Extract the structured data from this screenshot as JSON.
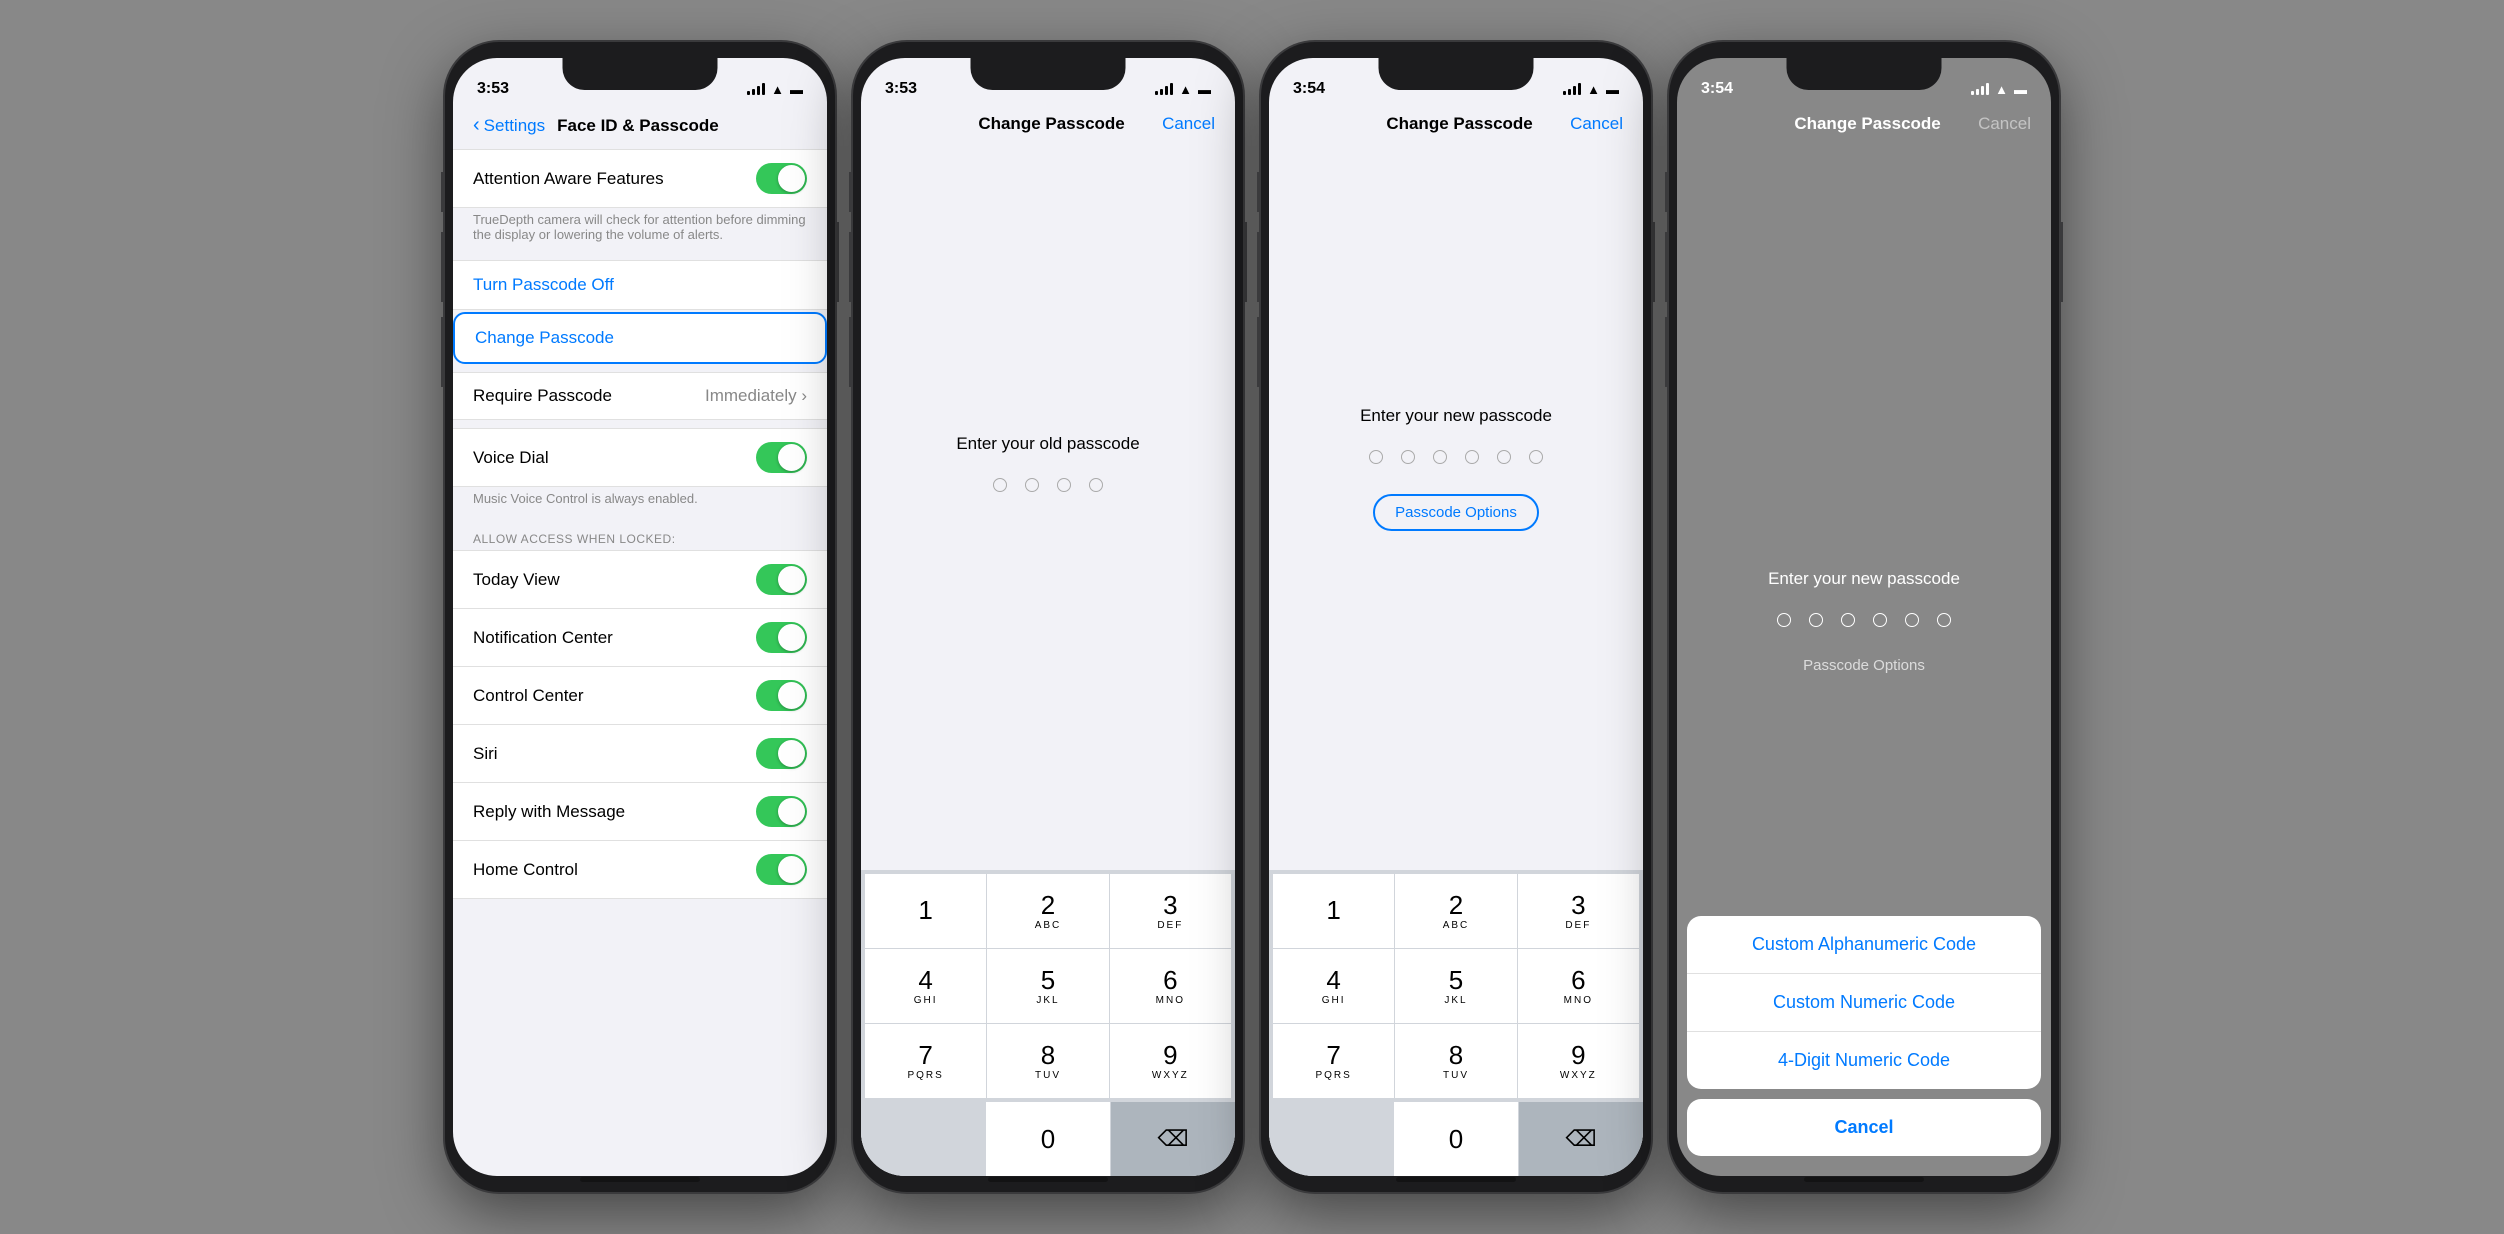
{
  "phones": [
    {
      "id": "phone1",
      "time": "3:53",
      "screen": "settings",
      "title": "Face ID & Passcode",
      "back_label": "Settings",
      "sections": [
        {
          "rows": [
            {
              "label": "Attention Aware Features",
              "type": "toggle",
              "value": true
            }
          ],
          "sublabel": "TrueDepth camera will check for attention before dimming the display or lowering the volume of alerts."
        },
        {
          "rows": [
            {
              "label": "Turn Passcode Off",
              "type": "link"
            },
            {
              "label": "Change Passcode",
              "type": "highlighted-link"
            }
          ]
        },
        {
          "rows": [
            {
              "label": "Require Passcode",
              "value": "Immediately",
              "type": "navigate"
            }
          ]
        },
        {
          "rows": [
            {
              "label": "Voice Dial",
              "type": "toggle",
              "value": true
            }
          ],
          "sublabel": "Music Voice Control is always enabled."
        },
        {
          "header": "ALLOW ACCESS WHEN LOCKED:",
          "rows": [
            {
              "label": "Today View",
              "type": "toggle",
              "value": true
            },
            {
              "label": "Notification Center",
              "type": "toggle",
              "value": true
            },
            {
              "label": "Control Center",
              "type": "toggle",
              "value": true
            },
            {
              "label": "Siri",
              "type": "toggle",
              "value": true
            },
            {
              "label": "Reply with Message",
              "type": "toggle",
              "value": true
            },
            {
              "label": "Home Control",
              "type": "toggle",
              "value": true
            }
          ]
        }
      ]
    },
    {
      "id": "phone2",
      "time": "3:53",
      "screen": "passcode",
      "title": "Change Passcode",
      "cancel_label": "Cancel",
      "prompt": "Enter your old passcode",
      "dot_count": 4,
      "show_options": false,
      "numpad": true
    },
    {
      "id": "phone3",
      "time": "3:54",
      "screen": "passcode",
      "title": "Change Passcode",
      "cancel_label": "Cancel",
      "prompt": "Enter your new passcode",
      "dot_count": 6,
      "show_options": true,
      "options_label": "Passcode Options",
      "numpad": true
    },
    {
      "id": "phone4",
      "time": "3:54",
      "screen": "passcode-options",
      "title": "Change Passcode",
      "cancel_label": "Cancel",
      "prompt": "Enter your new passcode",
      "dot_count": 6,
      "options_label": "Passcode Options",
      "action_sheet": {
        "items": [
          "Custom Alphanumeric Code",
          "Custom Numeric Code",
          "4-Digit Numeric Code"
        ],
        "cancel": "Cancel"
      }
    }
  ],
  "numpad_keys": [
    {
      "main": "1",
      "sub": ""
    },
    {
      "main": "2",
      "sub": "ABC"
    },
    {
      "main": "3",
      "sub": "DEF"
    },
    {
      "main": "4",
      "sub": "GHI"
    },
    {
      "main": "5",
      "sub": "JKL"
    },
    {
      "main": "6",
      "sub": "MNO"
    },
    {
      "main": "7",
      "sub": "PQRS"
    },
    {
      "main": "8",
      "sub": "TUV"
    },
    {
      "main": "9",
      "sub": "WXYZ"
    }
  ]
}
